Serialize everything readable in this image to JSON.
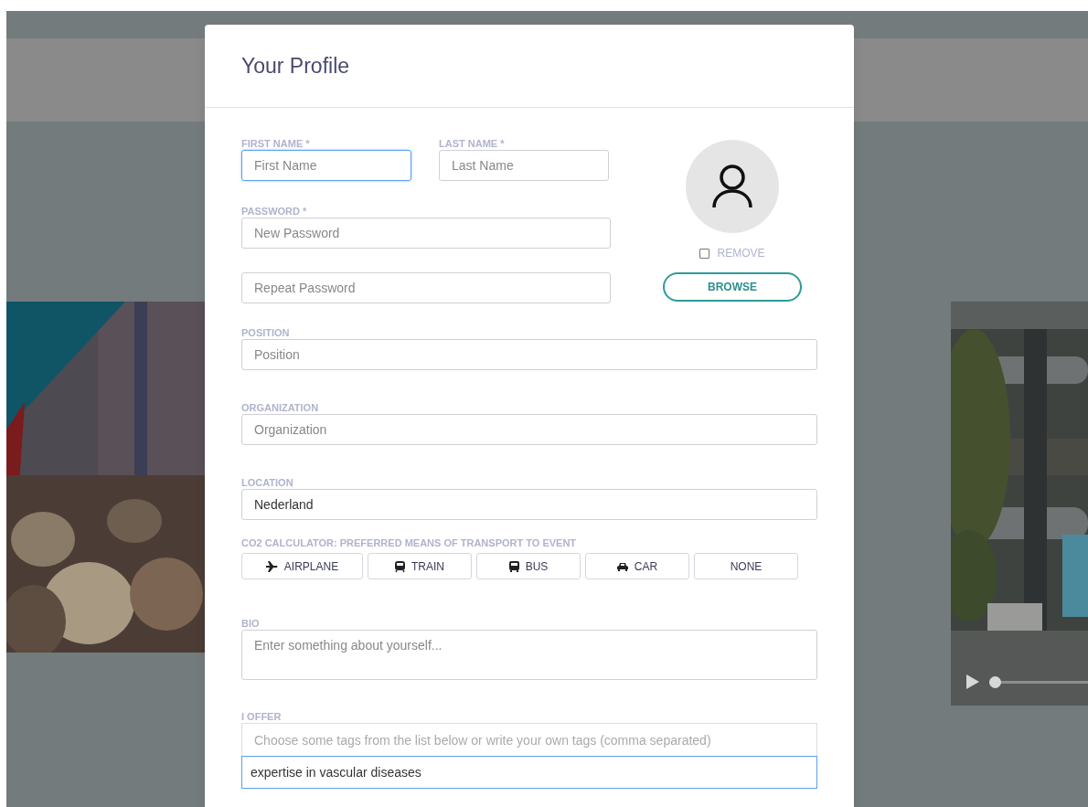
{
  "modal": {
    "title": "Your Profile"
  },
  "name_fields": [
    {
      "label": "FIRST NAME *",
      "placeholder": "First Name",
      "focused": true
    },
    {
      "label": "LAST NAME *",
      "placeholder": "Last Name",
      "focused": false
    }
  ],
  "password": {
    "label": "PASSWORD *",
    "fields": [
      {
        "placeholder": "New Password"
      },
      {
        "placeholder": "Repeat Password"
      }
    ]
  },
  "avatar": {
    "remove": {
      "label": "REMOVE",
      "checked": false
    },
    "browse_button": "BROWSE"
  },
  "fields": [
    {
      "label": "POSITION",
      "placeholder": "Position"
    },
    {
      "label": "ORGANIZATION",
      "placeholder": "Organization"
    },
    {
      "label": "LOCATION",
      "value": "Nederland"
    }
  ],
  "transport": {
    "label": "CO2 CALCULATOR: PREFERRED MEANS OF TRANSPORT TO EVENT",
    "options": [
      {
        "kind": "airplane",
        "label": "AIRPLANE",
        "selected": false
      },
      {
        "kind": "train",
        "label": "TRAIN",
        "selected": false
      },
      {
        "kind": "bus",
        "label": "BUS",
        "selected": false
      },
      {
        "kind": "car",
        "label": "CAR",
        "selected": false
      },
      {
        "kind": "none",
        "label": "NONE",
        "selected": false
      }
    ]
  },
  "bio": {
    "label": "BIO",
    "placeholder": "Enter something about yourself..."
  },
  "offer": {
    "label": "I OFFER",
    "placeholder": "Choose some tags from the list below or write your own tags (comma separated)",
    "value": "expertise in vascular diseases"
  },
  "background": {
    "video": {
      "kind": "picture",
      "level": 0
    }
  }
}
